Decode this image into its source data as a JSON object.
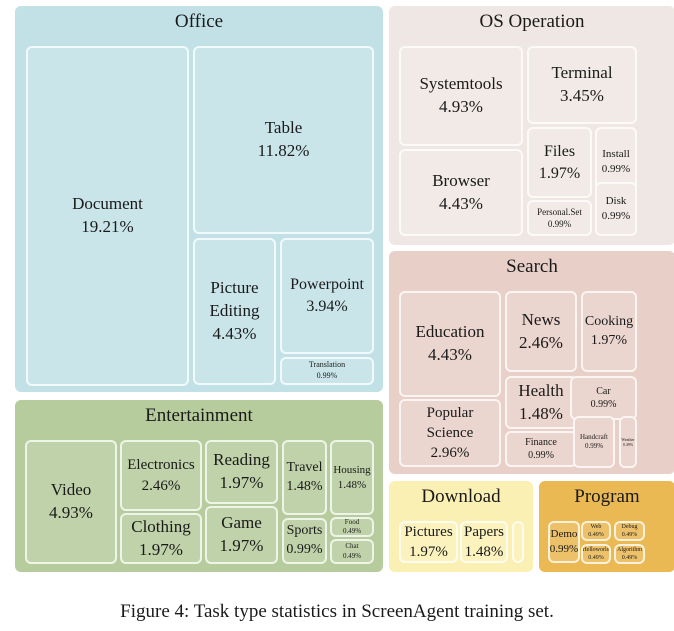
{
  "chart_data": {
    "type": "treemap",
    "title": "",
    "caption": "Figure 4: Task type statistics in ScreenAgent training set.",
    "groups": [
      {
        "name": "Office",
        "color": "#c2e1e6",
        "children": [
          {
            "name": "Document",
            "value": "19.21%"
          },
          {
            "name": "Table",
            "value": "11.82%"
          },
          {
            "name": "Picture Editing",
            "label_lines": [
              "Picture",
              "Editing"
            ],
            "value": "4.43%"
          },
          {
            "name": "Powerpoint",
            "value": "3.94%"
          },
          {
            "name": "Translation",
            "value": "0.99%"
          }
        ]
      },
      {
        "name": "OS Operation",
        "color": "#efe7e3",
        "children": [
          {
            "name": "Systemtools",
            "value": "4.93%"
          },
          {
            "name": "Browser",
            "value": "4.43%"
          },
          {
            "name": "Terminal",
            "value": "3.45%"
          },
          {
            "name": "Files",
            "value": "1.97%"
          },
          {
            "name": "Personal.Set",
            "value": "0.99%"
          },
          {
            "name": "Install",
            "value": "0.99%"
          },
          {
            "name": "Disk",
            "value": "0.99%"
          }
        ]
      },
      {
        "name": "Search",
        "color": "#e8cfc8",
        "children": [
          {
            "name": "Education",
            "value": "4.43%"
          },
          {
            "name": "Popular Science",
            "label_lines": [
              "Popular",
              "Science"
            ],
            "value": "2.96%"
          },
          {
            "name": "News",
            "value": "2.46%"
          },
          {
            "name": "Cooking",
            "value": "1.97%"
          },
          {
            "name": "Health",
            "value": "1.48%"
          },
          {
            "name": "Finance",
            "value": "0.99%"
          },
          {
            "name": "Car",
            "value": "0.99%"
          },
          {
            "name": "Handcraft",
            "value": "0.99%"
          },
          {
            "name": "Weather",
            "value": "0.49%"
          }
        ]
      },
      {
        "name": "Entertainment",
        "color": "#b7cc9d",
        "children": [
          {
            "name": "Video",
            "value": "4.93%"
          },
          {
            "name": "Electronics",
            "value": "2.46%"
          },
          {
            "name": "Clothing",
            "value": "1.97%"
          },
          {
            "name": "Reading",
            "value": "1.97%"
          },
          {
            "name": "Game",
            "value": "1.97%"
          },
          {
            "name": "Travel",
            "value": "1.48%"
          },
          {
            "name": "Sports",
            "value": "0.99%"
          },
          {
            "name": "Housing",
            "value": "1.48%"
          },
          {
            "name": "Food",
            "value": "0.49%"
          },
          {
            "name": "Chat",
            "value": "0.49%"
          }
        ]
      },
      {
        "name": "Download",
        "color": "#faf0b4",
        "children": [
          {
            "name": "Pictures",
            "value": "1.97%"
          },
          {
            "name": "Papers",
            "value": "1.48%"
          },
          {
            "name": "",
            "value": ""
          }
        ]
      },
      {
        "name": "Program",
        "color": "#eab954",
        "children": [
          {
            "name": "Demo",
            "value": "0.99%"
          },
          {
            "name": "Web",
            "value": "0.49%"
          },
          {
            "name": "Debug",
            "value": "0.49%"
          },
          {
            "name": "Helloworld",
            "value": "0.49%"
          },
          {
            "name": "Algorithm",
            "value": "0.49%"
          }
        ]
      }
    ]
  }
}
